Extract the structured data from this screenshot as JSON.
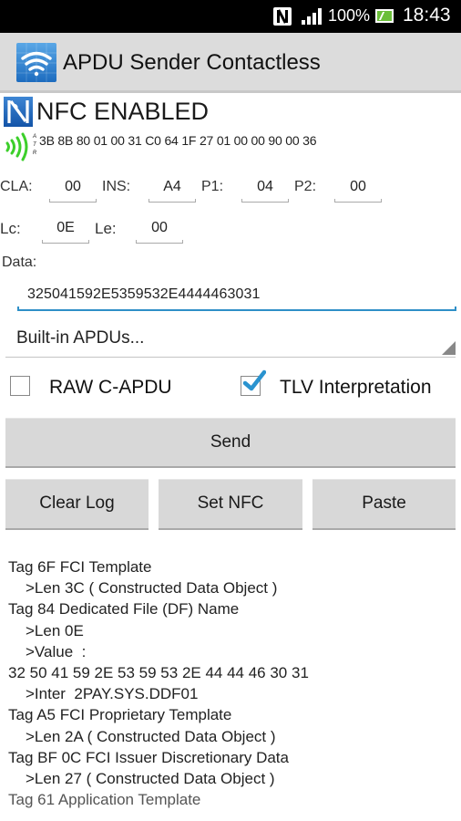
{
  "status_bar": {
    "battery_percent": "100%",
    "time": "18:43",
    "icons": [
      "nfc-icon",
      "signal-icon",
      "battery-charging-icon"
    ]
  },
  "action_bar": {
    "app_icon": "wifi-contactless-icon",
    "title": "APDU Sender Contactless"
  },
  "nfc_status": {
    "icon": "nfc-n-icon",
    "title": "NFC ENABLED",
    "rf_icon": "contactless-waves-icon",
    "atr_label": [
      "A",
      "T",
      "R"
    ],
    "atr_value": "3B 8B 80 01 00 31 C0 64 1F 27 01 00 00 90 00 36",
    "rf_color": "#3ccf2a"
  },
  "header_fields": {
    "cla": {
      "label": "CLA:",
      "value": "00"
    },
    "ins": {
      "label": "INS:",
      "value": "A4"
    },
    "p1": {
      "label": "P1:",
      "value": "04"
    },
    "p2": {
      "label": "P2:",
      "value": "00"
    },
    "lc": {
      "label": "Lc:",
      "value": "0E"
    },
    "le": {
      "label": "Le:",
      "value": "00"
    }
  },
  "data_field": {
    "label": "Data:",
    "value": "325041592E5359532E4444463031",
    "accent_color": "#2e8fc7"
  },
  "spinner": {
    "selected": "Built-in APDUs..."
  },
  "options": {
    "raw_capdu": {
      "label": "RAW C-APDU",
      "checked": false
    },
    "tlv_interpretation": {
      "label": "TLV Interpretation",
      "checked": true,
      "check_color": "#2a93cf"
    }
  },
  "buttons": {
    "send": "Send",
    "clear_log": "Clear Log",
    "set_nfc": "Set NFC",
    "paste": "Paste"
  },
  "log": {
    "lines": [
      {
        "text": "Tag 6F FCI Template",
        "indent": false
      },
      {
        "text": ">Len 3C ( Constructed Data Object )",
        "indent": true
      },
      {
        "text": "Tag 84 Dedicated File (DF) Name",
        "indent": false
      },
      {
        "text": ">Len 0E",
        "indent": true
      },
      {
        "text": ">Value  :",
        "indent": true
      },
      {
        "text": "32 50 41 59 2E 53 59 53 2E 44 44 46 30 31",
        "indent": false
      },
      {
        "text": ">Inter  2PAY.SYS.DDF01",
        "indent": true
      },
      {
        "text": "Tag A5 FCI Proprietary Template",
        "indent": false
      },
      {
        "text": ">Len 2A ( Constructed Data Object )",
        "indent": true
      },
      {
        "text": "Tag BF 0C FCI Issuer Discretionary Data",
        "indent": false
      },
      {
        "text": ">Len 27 ( Constructed Data Object )",
        "indent": true
      },
      {
        "text": "Tag 61 Application Template",
        "indent": false
      }
    ]
  }
}
